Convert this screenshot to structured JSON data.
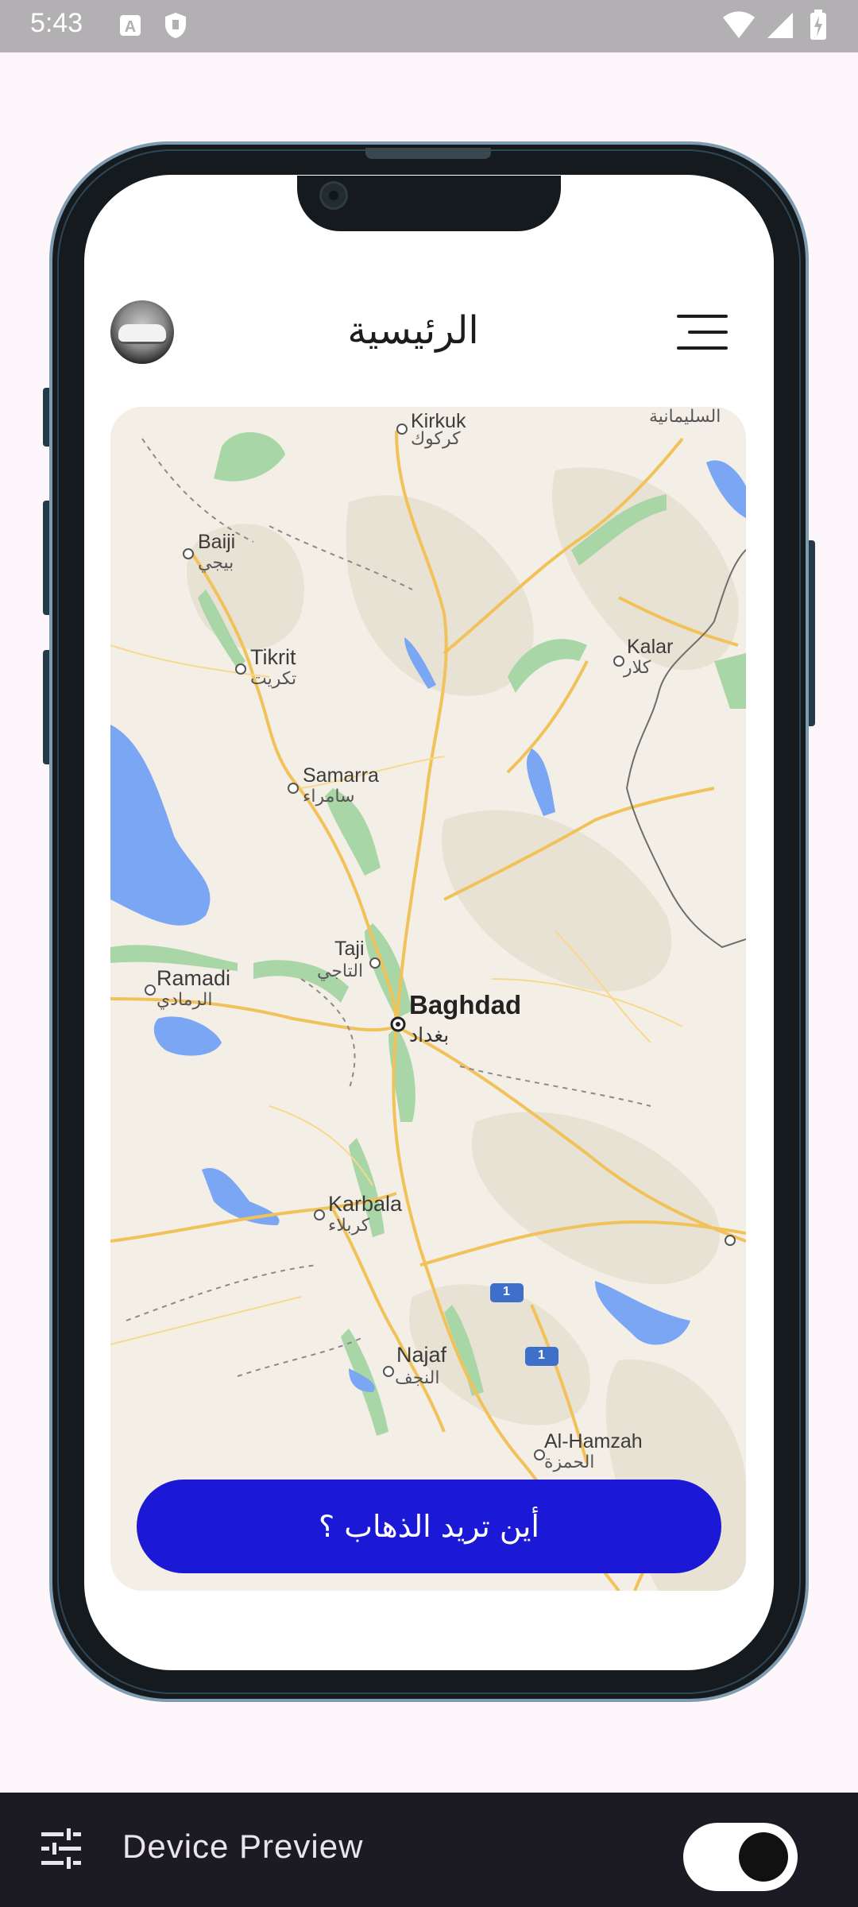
{
  "status_bar": {
    "time": "5:43",
    "icons": [
      "a-icon",
      "shield-icon",
      "wifi-icon",
      "signal-icon",
      "battery-charging-icon"
    ]
  },
  "app": {
    "title": "الرئيسية",
    "avatar": "profile-avatar-car",
    "menu_icon": "hamburger-menu-icon"
  },
  "map": {
    "labels": [
      {
        "key": "kirkuk",
        "en": "Kirkuk",
        "ar": "كركوك"
      },
      {
        "key": "sulaymaniyah",
        "ar": "السليمانية"
      },
      {
        "key": "baiji",
        "en": "Baiji",
        "ar": "بيجي"
      },
      {
        "key": "tikrit",
        "en": "Tikrit",
        "ar": "تكريت"
      },
      {
        "key": "kalar",
        "en": "Kalar",
        "ar": "كلار"
      },
      {
        "key": "samarra",
        "en": "Samarra",
        "ar": "سامراء"
      },
      {
        "key": "taji",
        "en": "Taji",
        "ar": "التاجي"
      },
      {
        "key": "ramadi",
        "en": "Ramadi",
        "ar": "الرمادي"
      },
      {
        "key": "baghdad",
        "en": "Baghdad",
        "ar": "بغداد"
      },
      {
        "key": "karbala",
        "en": "Karbala",
        "ar": "كربلاء"
      },
      {
        "key": "najaf",
        "en": "Najaf",
        "ar": "النجف"
      },
      {
        "key": "alhamzah",
        "en": "Al-Hamzah",
        "ar": "الحمزة"
      },
      {
        "key": "highway",
        "en": "1"
      }
    ]
  },
  "cta": {
    "label": "أين تريد الذهاب ؟"
  },
  "device_preview": {
    "title": "Device Preview",
    "settings_icon": "tune-icon",
    "toggle_on": true
  },
  "colors": {
    "accent": "#1c19d6",
    "frame": "#141a1d",
    "frame_edge": "#7e9bb0",
    "background": "#fdf7fc",
    "bottom_bar": "#1c1b24"
  }
}
